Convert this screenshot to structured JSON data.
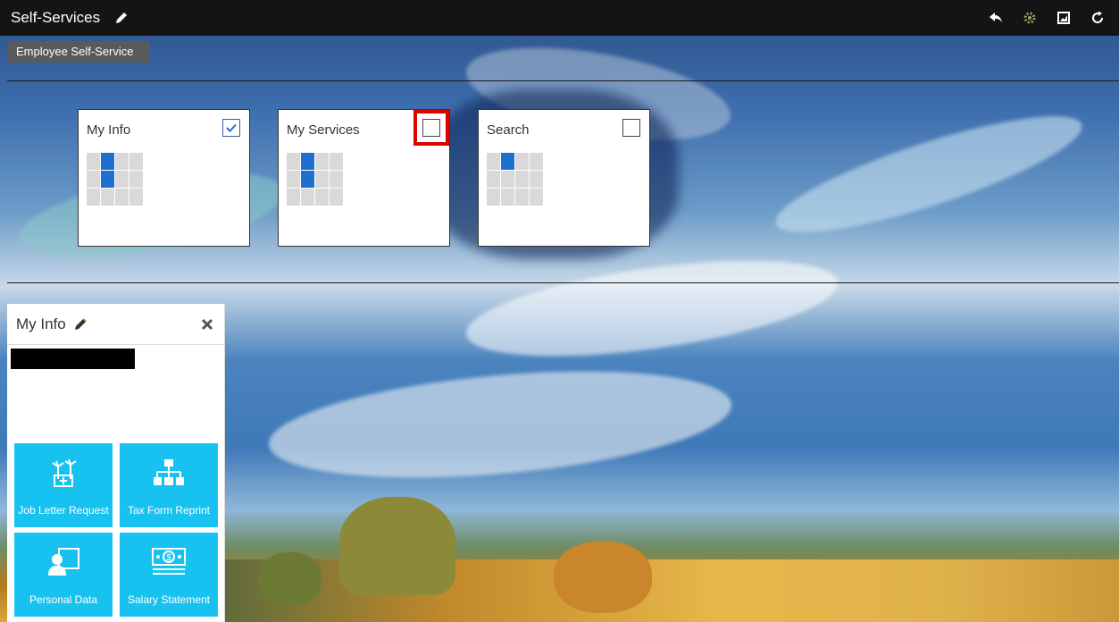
{
  "app": {
    "title": "Self-Services",
    "subtab": "Employee Self-Service"
  },
  "toolbar_icons": [
    "back-arrow-icon",
    "gear-icon",
    "image-icon",
    "refresh-icon"
  ],
  "tiles": [
    {
      "label": "My Info",
      "checked": true
    },
    {
      "label": "My Services",
      "checked": false
    },
    {
      "label": "Search",
      "checked": false
    }
  ],
  "panel": {
    "title": "My Info",
    "services": [
      {
        "label": "Job Letter Request",
        "icon": "palm-trees-icon"
      },
      {
        "label": "Tax Form Reprint",
        "icon": "org-chart-icon"
      },
      {
        "label": "Personal Data",
        "icon": "user-board-icon"
      },
      {
        "label": "Salary Statement",
        "icon": "money-bill-icon"
      }
    ]
  },
  "colors": {
    "topbar": "#141414",
    "tile_accent": "#1e6fd0",
    "service_tile": "#18c2f0",
    "highlight": "#e00000"
  }
}
